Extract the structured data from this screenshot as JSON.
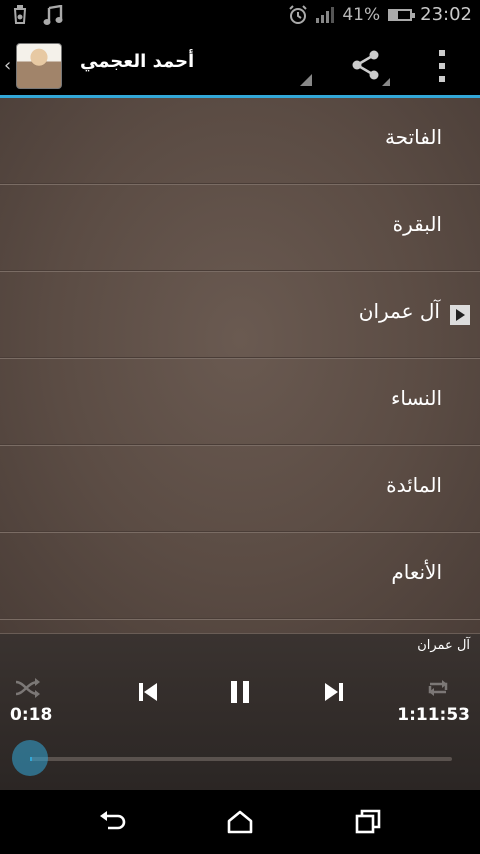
{
  "status_bar": {
    "battery_percent": "41%",
    "battery_level": 0.41,
    "time": "23:02",
    "icons": [
      "lantern-icon",
      "music-note-icon",
      "alarm-icon",
      "signal-icon",
      "battery-icon"
    ]
  },
  "action_bar": {
    "title": "أحمد العجمي",
    "icons": [
      "chevron-left-icon",
      "avatar-image",
      "share-icon",
      "overflow-menu-icon"
    ]
  },
  "surah_list": [
    {
      "name": "الفاتحة",
      "playing": false
    },
    {
      "name": "البقرة",
      "playing": false
    },
    {
      "name": "آل عمران",
      "playing": true
    },
    {
      "name": "النساء",
      "playing": false
    },
    {
      "name": "المائدة",
      "playing": false
    },
    {
      "name": "الأنعام",
      "playing": false
    }
  ],
  "player": {
    "now_playing": "آل عمران",
    "elapsed": "0:18",
    "total": "1:11:53",
    "progress_fraction": 0.004,
    "icons": [
      "shuffle-icon",
      "previous-icon",
      "pause-icon",
      "next-icon",
      "repeat-icon"
    ]
  },
  "nav_bar": {
    "icons": [
      "back-icon",
      "home-icon",
      "recent-apps-icon"
    ]
  },
  "colors": {
    "accent": "#33a7d7",
    "list_background": "#5b4c44",
    "player_background": "#2b2624"
  }
}
